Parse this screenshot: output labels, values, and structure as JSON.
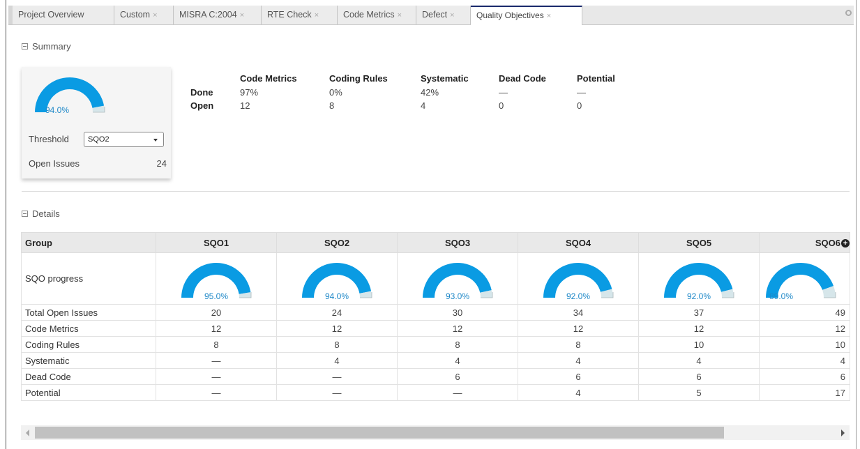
{
  "colors": {
    "gauge_fill": "#0a9be3",
    "gauge_rest": "#d6e6ea",
    "value_text": "#1e88c8"
  },
  "tabs": [
    {
      "label": "Project Overview",
      "closable": false
    },
    {
      "label": "Custom",
      "closable": true
    },
    {
      "label": "MISRA C:2004",
      "closable": true
    },
    {
      "label": "RTE Check",
      "closable": true
    },
    {
      "label": "Code Metrics",
      "closable": true
    },
    {
      "label": "Defect",
      "closable": true
    },
    {
      "label": "Quality Objectives",
      "closable": true,
      "active": true
    }
  ],
  "close_glyph": "×",
  "summary": {
    "title": "Summary",
    "gauge": {
      "value": 0.94,
      "label": "94.0%"
    },
    "threshold_label": "Threshold",
    "threshold_value": "SQO2",
    "open_issues_label": "Open Issues",
    "open_issues_value": "24",
    "columns": [
      "Code Metrics",
      "Coding Rules",
      "Systematic",
      "Dead Code",
      "Potential"
    ],
    "rows": [
      {
        "label": "Done",
        "values": [
          "97%",
          "0%",
          "42%",
          "—",
          "—"
        ]
      },
      {
        "label": "Open",
        "values": [
          "12",
          "8",
          "4",
          "0",
          "0"
        ]
      }
    ]
  },
  "details": {
    "title": "Details",
    "group_header": "Group",
    "columns": [
      "SQO1",
      "SQO2",
      "SQO3",
      "SQO4",
      "SQO5",
      "SQO6"
    ],
    "progress_label": "SQO progress",
    "progress": [
      {
        "value": 0.95,
        "label": "95.0%"
      },
      {
        "value": 0.94,
        "label": "94.0%"
      },
      {
        "value": 0.93,
        "label": "93.0%"
      },
      {
        "value": 0.92,
        "label": "92.0%"
      },
      {
        "value": 0.92,
        "label": "92.0%"
      },
      {
        "value": 0.89,
        "label": "89.0%"
      }
    ],
    "rows": [
      {
        "label": "Total Open Issues",
        "values": [
          "20",
          "24",
          "30",
          "34",
          "37",
          "49"
        ]
      },
      {
        "label": "Code Metrics",
        "values": [
          "12",
          "12",
          "12",
          "12",
          "12",
          "12"
        ]
      },
      {
        "label": "Coding Rules",
        "values": [
          "8",
          "8",
          "8",
          "8",
          "10",
          "10"
        ]
      },
      {
        "label": "Systematic",
        "values": [
          "—",
          "4",
          "4",
          "4",
          "4",
          "4"
        ]
      },
      {
        "label": "Dead Code",
        "values": [
          "—",
          "—",
          "6",
          "6",
          "6",
          "6"
        ]
      },
      {
        "label": "Potential",
        "values": [
          "—",
          "—",
          "—",
          "4",
          "5",
          "17"
        ]
      }
    ]
  }
}
